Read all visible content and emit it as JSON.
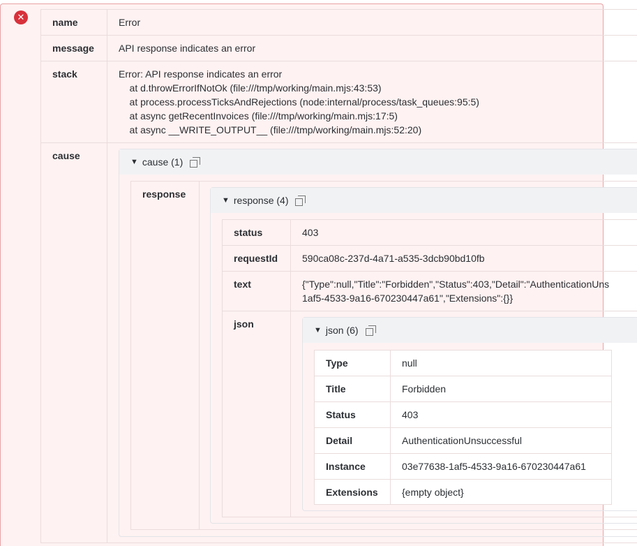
{
  "error": {
    "name_key": "name",
    "name_value": "Error",
    "message_key": "message",
    "message_value": "API response indicates an error",
    "stack_key": "stack",
    "stack_lines": [
      "Error: API response indicates an error",
      "    at d.throwErrorIfNotOk (file:///tmp/working/main.mjs:43:53)",
      "    at process.processTicksAndRejections (node:internal/process/task_queues:95:5)",
      "    at async getRecentInvoices (file:///tmp/working/main.mjs:17:5)",
      "    at async __WRITE_OUTPUT__ (file:///tmp/working/main.mjs:52:20)"
    ],
    "cause_key": "cause"
  },
  "cause": {
    "header": "cause (1)",
    "response_key": "response"
  },
  "response": {
    "header": "response (4)",
    "status_key": "status",
    "status_value": "403",
    "requestId_key": "requestId",
    "requestId_value": "590ca08c-237d-4a71-a535-3dcb90bd10fb",
    "text_key": "text",
    "text_line1": "{\"Type\":null,\"Title\":\"Forbidden\",\"Status\":403,\"Detail\":\"AuthenticationUns",
    "text_line2": "1af5-4533-9a16-670230447a61\",\"Extensions\":{}}",
    "json_key": "json"
  },
  "json": {
    "header": "json (6)",
    "rows": [
      {
        "key": "Type",
        "value": "null"
      },
      {
        "key": "Title",
        "value": "Forbidden"
      },
      {
        "key": "Status",
        "value": "403"
      },
      {
        "key": "Detail",
        "value": "AuthenticationUnsuccessful"
      },
      {
        "key": "Instance",
        "value": "03e77638-1af5-4533-9a16-670230447a61"
      },
      {
        "key": "Extensions",
        "value": "{empty object}"
      }
    ]
  },
  "icons": {
    "error": "close-circle-icon",
    "expand": "triangle-down-icon",
    "copy": "copy-icon"
  },
  "colors": {
    "error_accent": "#d8313b",
    "panel_bg": "#fff2f2",
    "header_bg": "#f1f2f4"
  }
}
